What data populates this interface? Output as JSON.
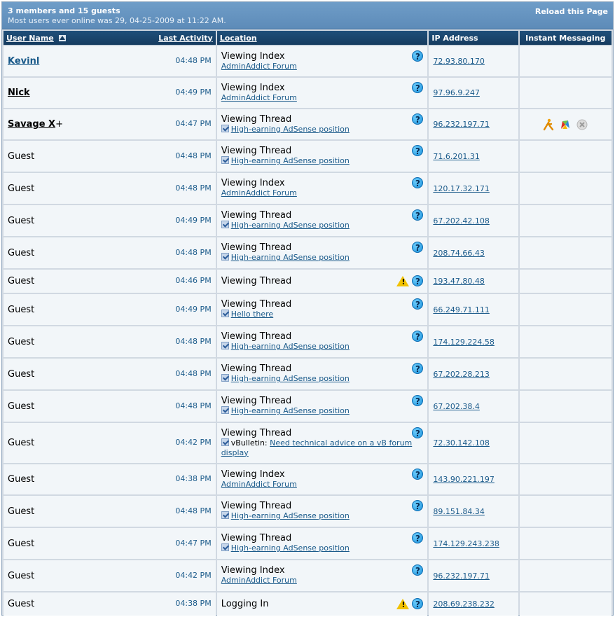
{
  "header": {
    "title": "3 members and 15 guests",
    "subtitle": "Most users ever online was 29, 04-25-2009 at 11:22 AM.",
    "reload": "Reload this Page"
  },
  "columns": {
    "username": "User Name",
    "last_activity": "Last Activity",
    "location": "Location",
    "ip": "IP Address",
    "im": "Instant Messaging"
  },
  "rows": [
    {
      "user": "Kevinl",
      "member": "admin",
      "time": "04:48 PM",
      "action": "Viewing Index",
      "target": "AdminAddict Forum",
      "target_type": "forum",
      "ip": "72.93.80.170"
    },
    {
      "user": "Nick",
      "member": "member",
      "time": "04:49 PM",
      "action": "Viewing Index",
      "target": "AdminAddict Forum",
      "target_type": "forum",
      "ip": "97.96.9.247"
    },
    {
      "user": "Savage X",
      "suffix": "+",
      "member": "member",
      "time": "04:47 PM",
      "action": "Viewing Thread",
      "target": "High-earning AdSense position",
      "target_type": "thread",
      "ip": "96.232.197.71",
      "im": true
    },
    {
      "user": "Guest",
      "time": "04:48 PM",
      "action": "Viewing Thread",
      "target": "High-earning AdSense position",
      "target_type": "thread",
      "ip": "71.6.201.31"
    },
    {
      "user": "Guest",
      "time": "04:48 PM",
      "action": "Viewing Index",
      "target": "AdminAddict Forum",
      "target_type": "forum",
      "ip": "120.17.32.171"
    },
    {
      "user": "Guest",
      "time": "04:49 PM",
      "action": "Viewing Thread",
      "target": "High-earning AdSense position",
      "target_type": "thread",
      "ip": "67.202.42.108"
    },
    {
      "user": "Guest",
      "time": "04:48 PM",
      "action": "Viewing Thread",
      "target": "High-earning AdSense position",
      "target_type": "thread",
      "ip": "208.74.66.43"
    },
    {
      "user": "Guest",
      "time": "04:46 PM",
      "action": "Viewing Thread",
      "target": "",
      "target_type": "none",
      "ip": "193.47.80.48",
      "warn": true
    },
    {
      "user": "Guest",
      "time": "04:49 PM",
      "action": "Viewing Thread",
      "target": "Hello there",
      "target_type": "thread",
      "ip": "66.249.71.111"
    },
    {
      "user": "Guest",
      "time": "04:48 PM",
      "action": "Viewing Thread",
      "target": "High-earning AdSense position",
      "target_type": "thread",
      "ip": "174.129.224.58"
    },
    {
      "user": "Guest",
      "time": "04:48 PM",
      "action": "Viewing Thread",
      "target": "High-earning AdSense position",
      "target_type": "thread",
      "ip": "67.202.28.213"
    },
    {
      "user": "Guest",
      "time": "04:48 PM",
      "action": "Viewing Thread",
      "target": "High-earning AdSense position",
      "target_type": "thread",
      "ip": "67.202.38.4"
    },
    {
      "user": "Guest",
      "time": "04:42 PM",
      "action": "Viewing Thread",
      "prefix": "vBulletin:",
      "target": "Need technical advice on a vB forum display",
      "target_type": "thread",
      "ip": "72.30.142.108"
    },
    {
      "user": "Guest",
      "time": "04:38 PM",
      "action": "Viewing Index",
      "target": "AdminAddict Forum",
      "target_type": "forum",
      "ip": "143.90.221.197"
    },
    {
      "user": "Guest",
      "time": "04:48 PM",
      "action": "Viewing Thread",
      "target": "High-earning AdSense position",
      "target_type": "thread",
      "ip": "89.151.84.34"
    },
    {
      "user": "Guest",
      "time": "04:47 PM",
      "action": "Viewing Thread",
      "target": "High-earning AdSense position",
      "target_type": "thread",
      "ip": "174.129.243.238"
    },
    {
      "user": "Guest",
      "time": "04:42 PM",
      "action": "Viewing Index",
      "target": "AdminAddict Forum",
      "target_type": "forum",
      "ip": "96.232.197.71"
    },
    {
      "user": "Guest",
      "time": "04:38 PM",
      "action": "Logging In",
      "target": "",
      "target_type": "none",
      "ip": "208.69.238.232",
      "warn": true
    }
  ],
  "colors": {
    "header_bg": "#5d8bb8",
    "column_header_bg": "#163c60",
    "cell_bg": "#f2f6f9",
    "link": "#1a5a8a"
  },
  "icons": [
    "sort-asc-icon",
    "help-icon",
    "warning-icon",
    "thread-read-icon",
    "aim-icon",
    "msn-icon",
    "yahoo-icon"
  ]
}
